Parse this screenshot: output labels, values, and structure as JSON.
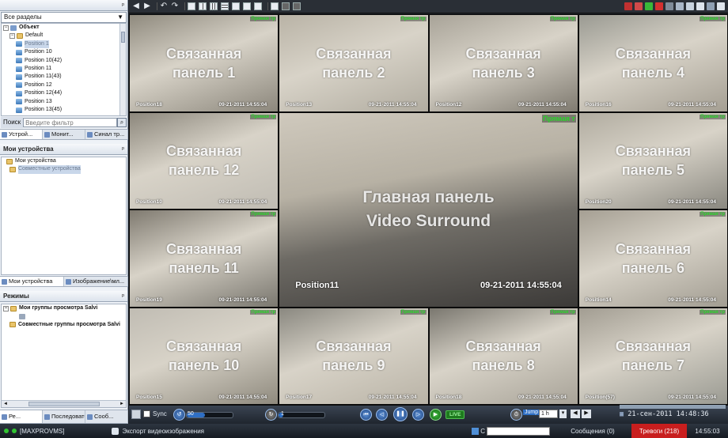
{
  "sidebar": {
    "section_select": "Все разделы",
    "pin": "ᵖ",
    "tree": [
      {
        "label": "Объект",
        "level": 0,
        "type": "obj",
        "expand": "−"
      },
      {
        "label": "Default",
        "level": 1,
        "type": "fold",
        "expand": "−"
      },
      {
        "label": "Position 1",
        "level": 2,
        "type": "cam",
        "selected": true
      },
      {
        "label": "Position 10",
        "level": 2,
        "type": "cam"
      },
      {
        "label": "Position 10(42)",
        "level": 2,
        "type": "cam"
      },
      {
        "label": "Position 11",
        "level": 2,
        "type": "cam"
      },
      {
        "label": "Position 11(43)",
        "level": 2,
        "type": "cam"
      },
      {
        "label": "Position 12",
        "level": 2,
        "type": "cam"
      },
      {
        "label": "Position 12(44)",
        "level": 2,
        "type": "cam"
      },
      {
        "label": "Position 13",
        "level": 2,
        "type": "cam"
      },
      {
        "label": "Position 13(45)",
        "level": 2,
        "type": "cam"
      }
    ],
    "search_label": "Поиск",
    "search_placeholder": "Введите фильтр",
    "tabs1": [
      "Устрой...",
      "Монит...",
      "Синал тр..."
    ],
    "devices_title": "Мои устройства",
    "devices_tree": [
      "Мои устройства",
      "Совместные устройства"
    ],
    "tabs2": [
      "Мои устройства",
      "Изображение\\мл..."
    ],
    "modes_title": "Режимы",
    "modes_tree": [
      "Мои группы просмотра Salvi",
      "Совместные группы просмотра Salvi"
    ],
    "tabs3": [
      "Ре...",
      "Последовате...",
      "Сооб..."
    ]
  },
  "grid": {
    "live_label": "Прямая тр",
    "main": {
      "title_line1": "Главная панель",
      "title_line2": "Video Surround",
      "position": "Position11",
      "timestamp": "09-21-2011 14:55:04",
      "live": "Прямая т"
    },
    "cells": [
      {
        "line1": "Связанная",
        "line2": "панель 1",
        "position": "Position18",
        "timestamp": "09-21-2011 14:55:04"
      },
      {
        "line1": "Связанная",
        "line2": "панель 2",
        "position": "Position13",
        "timestamp": "09-21-2011 14:55:04"
      },
      {
        "line1": "Связанная",
        "line2": "панель 3",
        "position": "Position12",
        "timestamp": "09-21-2011 14:55:04"
      },
      {
        "line1": "Связанная",
        "line2": "панель 4",
        "position": "Position16",
        "timestamp": "09-21-2011 14:55:04"
      },
      {
        "line1": "Связанная",
        "line2": "панель 12",
        "position": "Position10",
        "timestamp": "09-21-2011 14:55:04"
      },
      {
        "line1": "Связанная",
        "line2": "панель 5",
        "position": "Position20",
        "timestamp": "09-21-2011 14:55:04"
      },
      {
        "line1": "Связанная",
        "line2": "панель 11",
        "position": "Position19",
        "timestamp": "09-21-2011 14:55:04"
      },
      {
        "line1": "Связанная",
        "line2": "панель 6",
        "position": "Position14",
        "timestamp": "09-21-2011 14:55:04"
      },
      {
        "line1": "Связанная",
        "line2": "панель 10",
        "position": "Position15",
        "timestamp": "09-21-2011 14:55:04"
      },
      {
        "line1": "Связанная",
        "line2": "панель 9",
        "position": "Position17",
        "timestamp": "09-21-2011 14:55:04"
      },
      {
        "line1": "Связанная",
        "line2": "панель 8",
        "position": "Position18",
        "timestamp": "09-21-2011 14:55:04"
      },
      {
        "line1": "Связанная",
        "line2": "панель 7",
        "position": "Position(57)",
        "timestamp": "09-21-2011 14:55:04"
      }
    ]
  },
  "playbar": {
    "sync_label": "Sync",
    "speed_value": "50",
    "step_value": "1",
    "live_button": "LIVE",
    "jump_label": "Jump",
    "jump_value": "1 h",
    "clock": "21-сен-2011 14:48:36"
  },
  "taskbar": {
    "profile": "[MAXPROVMS]",
    "export": "Экспорт видеоизображения",
    "input_prefix": "C",
    "messages": "Сообщения (0)",
    "alarms": "Тревоги (218)",
    "time": "14:55:03",
    "colors": {
      "alarm_bg": "#c81e1e"
    }
  }
}
